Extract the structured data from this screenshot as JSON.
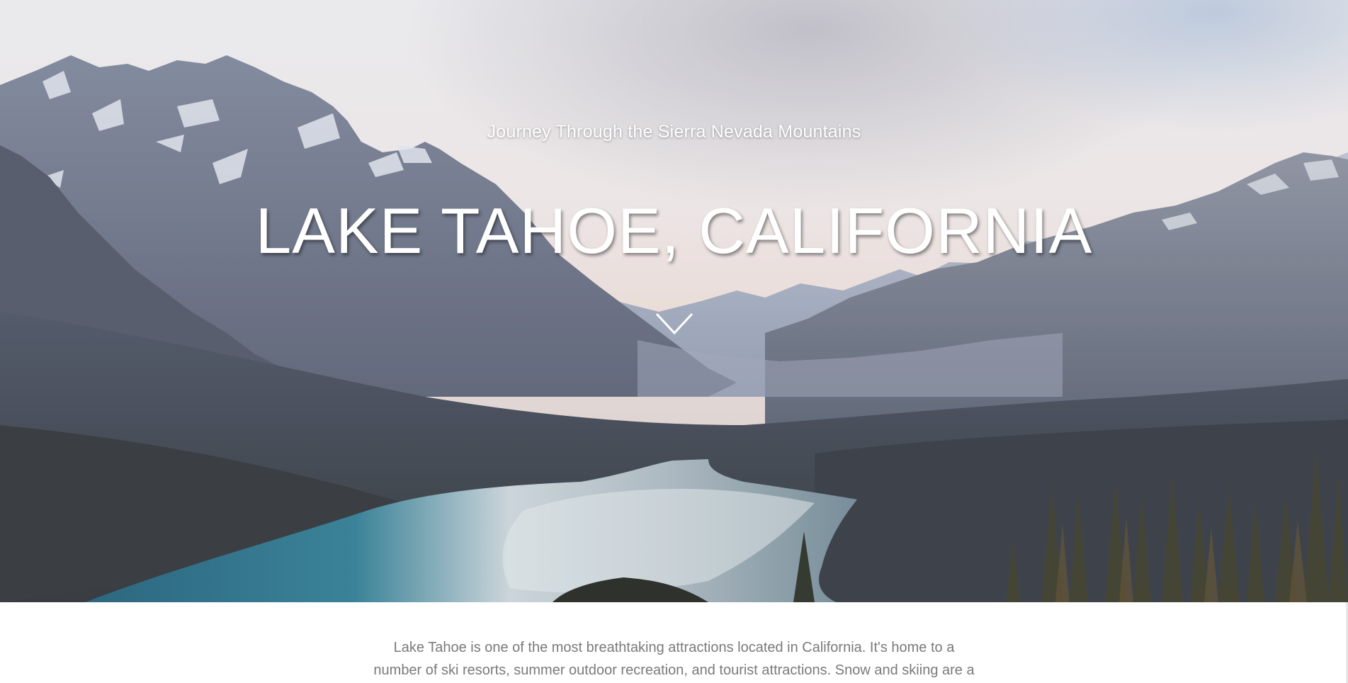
{
  "hero": {
    "subtitle": "Journey Through the Sierra Nevada Mountains",
    "title": "LAKE TAHOE, CALIFORNIA",
    "scroll_icon": "chevron-down-icon",
    "background": "mountain-lake-landscape"
  },
  "intro": {
    "text": "Lake Tahoe is one of the most breathtaking attractions located in California. It's home to a number of ski resorts, summer outdoor recreation, and tourist attractions. Snow and skiing are a"
  },
  "colors": {
    "hero_text": "#ffffff",
    "body_text": "#7a7a7a",
    "lake": "#2f6f86",
    "sky": "#e7e4e6"
  }
}
